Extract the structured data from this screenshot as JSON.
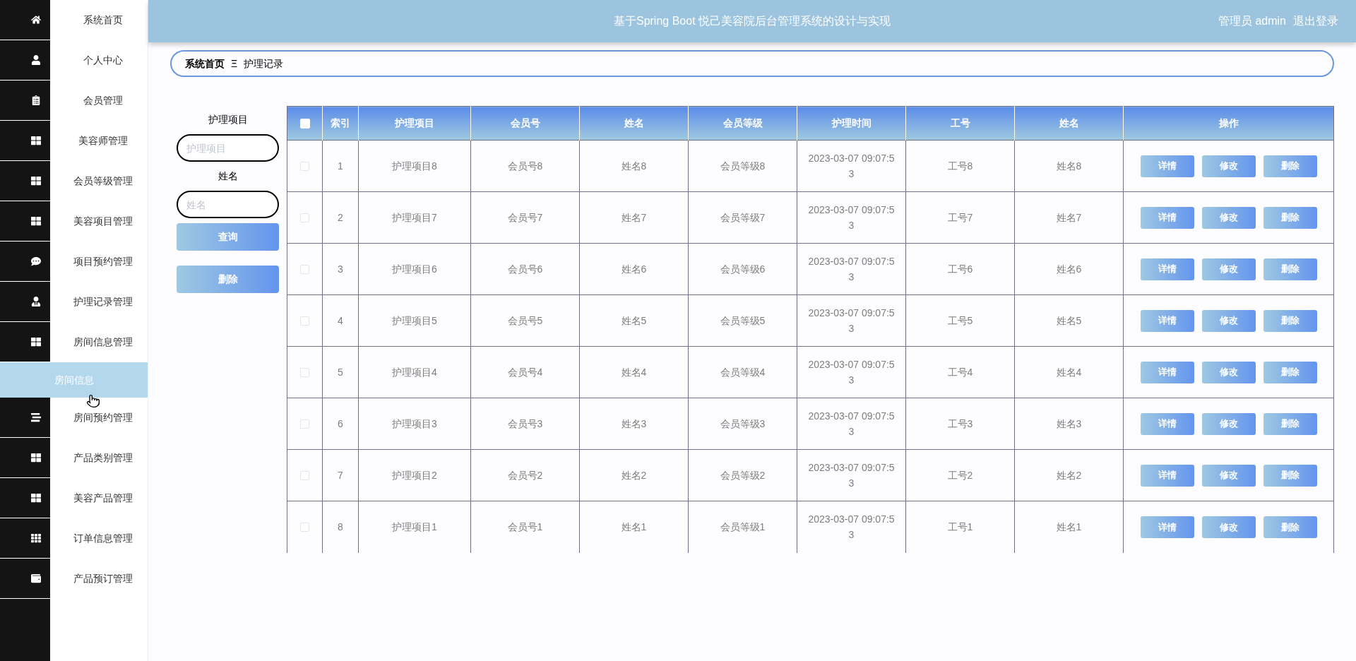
{
  "sidebar": {
    "items": [
      {
        "label": "系统首页"
      },
      {
        "label": "个人中心"
      },
      {
        "label": "会员管理"
      },
      {
        "label": "美容师管理"
      },
      {
        "label": "会员等级管理"
      },
      {
        "label": "美容项目管理"
      },
      {
        "label": "项目预约管理"
      },
      {
        "label": "护理记录管理"
      },
      {
        "label": "房间信息管理",
        "children": [
          {
            "label": "房间信息"
          }
        ]
      },
      {
        "label": "房间预约管理"
      },
      {
        "label": "产品类别管理"
      },
      {
        "label": "美容产品管理"
      },
      {
        "label": "订单信息管理"
      },
      {
        "label": "产品预订管理"
      }
    ]
  },
  "header": {
    "title": "基于Spring Boot 悦己美容院后台管理系统的设计与实现",
    "user": "管理员 admin",
    "logout": "退出登录"
  },
  "breadcrumb": {
    "items": [
      "系统首页",
      "护理记录"
    ],
    "separator": "Ξ"
  },
  "search": {
    "fields": [
      {
        "label": "护理项目",
        "placeholder": "护理项目"
      },
      {
        "label": "姓名",
        "placeholder": "姓名"
      }
    ],
    "buttons": [
      "查询",
      "删除"
    ]
  },
  "table": {
    "select_all": {
      "checked": false
    },
    "columns": [
      "索引",
      "护理项目",
      "会员号",
      "姓名",
      "会员等级",
      "护理时间",
      "工号",
      "姓名",
      "操作"
    ],
    "rows": [
      {
        "checked": false,
        "cells": [
          "1",
          "护理项目8",
          "会员号8",
          "姓名8",
          "会员等级8",
          "2023-03-07 09:07:53",
          "工号8",
          "姓名8"
        ],
        "actions": [
          "详情",
          "修改",
          "删除"
        ]
      },
      {
        "checked": false,
        "cells": [
          "2",
          "护理项目7",
          "会员号7",
          "姓名7",
          "会员等级7",
          "2023-03-07 09:07:53",
          "工号7",
          "姓名7"
        ],
        "actions": [
          "详情",
          "修改",
          "删除"
        ]
      },
      {
        "checked": false,
        "cells": [
          "3",
          "护理项目6",
          "会员号6",
          "姓名6",
          "会员等级6",
          "2023-03-07 09:07:53",
          "工号6",
          "姓名6"
        ],
        "actions": [
          "详情",
          "修改",
          "删除"
        ]
      },
      {
        "checked": false,
        "cells": [
          "4",
          "护理项目5",
          "会员号5",
          "姓名5",
          "会员等级5",
          "2023-03-07 09:07:53",
          "工号5",
          "姓名5"
        ],
        "actions": [
          "详情",
          "修改",
          "删除"
        ]
      },
      {
        "checked": false,
        "cells": [
          "5",
          "护理项目4",
          "会员号4",
          "姓名4",
          "会员等级4",
          "2023-03-07 09:07:53",
          "工号4",
          "姓名4"
        ],
        "actions": [
          "详情",
          "修改",
          "删除"
        ]
      },
      {
        "checked": false,
        "cells": [
          "6",
          "护理项目3",
          "会员号3",
          "姓名3",
          "会员等级3",
          "2023-03-07 09:07:53",
          "工号3",
          "姓名3"
        ],
        "actions": [
          "详情",
          "修改",
          "删除"
        ]
      },
      {
        "checked": false,
        "cells": [
          "7",
          "护理项目2",
          "会员号2",
          "姓名2",
          "会员等级2",
          "2023-03-07 09:07:53",
          "工号2",
          "姓名2"
        ],
        "actions": [
          "详情",
          "修改",
          "删除"
        ]
      },
      {
        "checked": false,
        "cells": [
          "8",
          "护理项目1",
          "会员号1",
          "姓名1",
          "会员等级1",
          "2023-03-07 09:07:53",
          "工号1",
          "姓名1"
        ],
        "actions": [
          "详情",
          "修改",
          "删除"
        ]
      }
    ]
  }
}
